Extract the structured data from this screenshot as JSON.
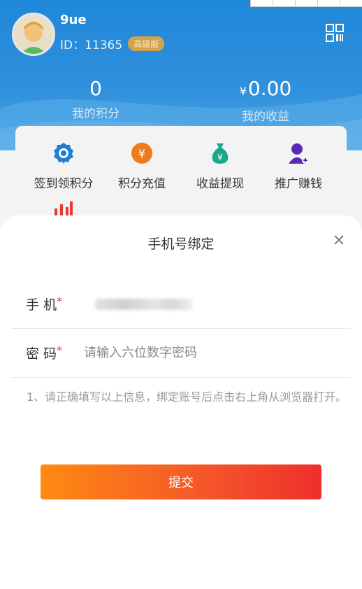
{
  "user": {
    "name": "9ue",
    "id_label": "ID：11365",
    "badge": "高级版"
  },
  "icons": {
    "qrcode": "qrcode-icon",
    "close": "close-icon"
  },
  "stats": {
    "points": {
      "value": "0",
      "label": "我的积分"
    },
    "income": {
      "currency": "¥",
      "value": "0.00",
      "label": "我的收益"
    }
  },
  "menu": {
    "items": [
      {
        "label": "签到领积分",
        "icon": "badge-icon",
        "color": "#1c7fd6"
      },
      {
        "label": "积分充值",
        "icon": "yen-coin-icon",
        "color": "#f07b1d"
      },
      {
        "label": "收益提现",
        "icon": "money-bag-icon",
        "color": "#1ca78e"
      },
      {
        "label": "推广赚钱",
        "icon": "add-user-icon",
        "color": "#5b2bb5"
      }
    ],
    "partial_icon": "bar-chart-icon"
  },
  "modal": {
    "title": "手机号绑定",
    "phone": {
      "label": "手 机",
      "required_mark": "*",
      "value": ""
    },
    "password": {
      "label": "密 码",
      "required_mark": "*",
      "placeholder": "请输入六位数字密码"
    },
    "notice": "1、请正确填写以上信息，绑定账号后点击右上角从浏览器打开。",
    "submit_label": "提交"
  },
  "colors": {
    "header": "#2f8fdc",
    "submit_start": "#ff8a12",
    "submit_end": "#ee2f2b",
    "required": "#e53935"
  }
}
